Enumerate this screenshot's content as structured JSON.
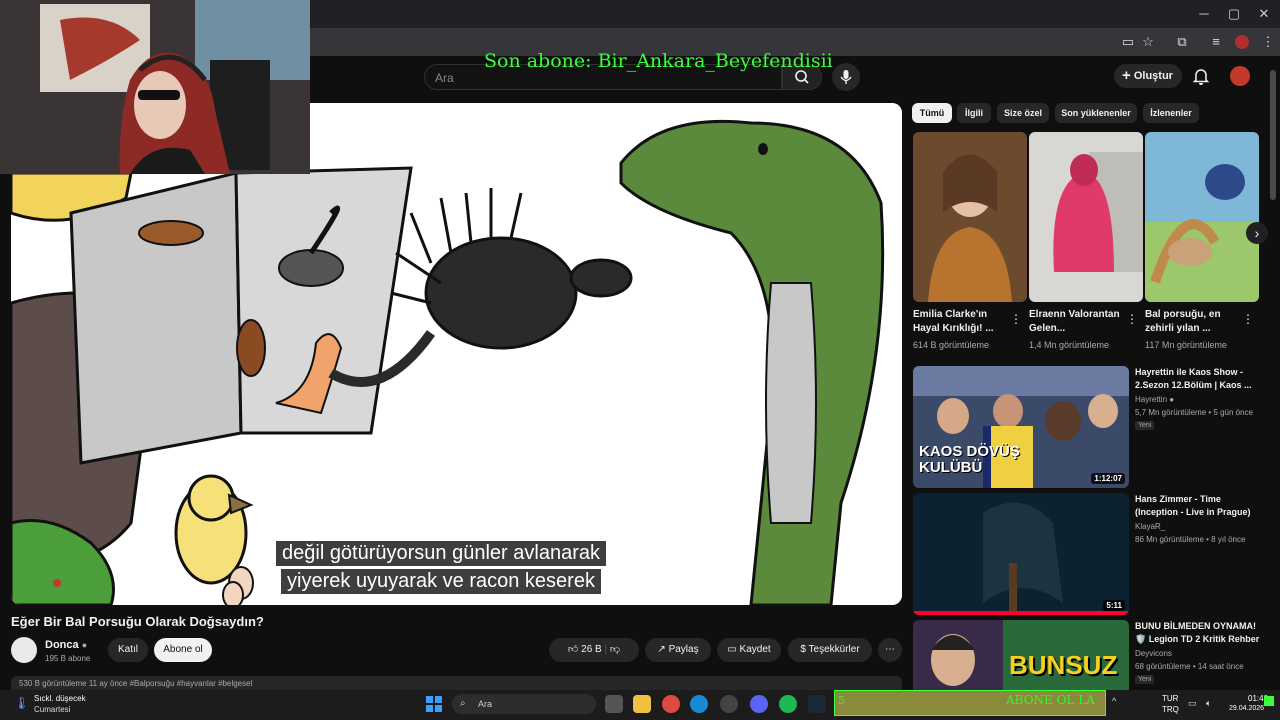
{
  "overlay": {
    "last_subscriber": "Son abone: Bir_Ankara_Beyefendisii"
  },
  "header": {
    "search_placeholder": "Ara",
    "create_label": "Oluştur"
  },
  "video": {
    "subtitle_line1": "değil götürüyorsun günler avlanarak",
    "subtitle_line2": "yiyerek uyuyarak ve racon keserek",
    "title": "Eğer Bir Bal Porsuğu Olarak Doğsaydın?",
    "channel": "Donca",
    "subscribers": "195 B abone",
    "join_label": "Katıl",
    "subscribe_label": "Abone ol",
    "likes": "26 B",
    "share_label": "Paylaş",
    "save_label": "Kaydet",
    "thanks_label": "Teşekkürler",
    "description_partial": "530 B görüntüleme  11 ay önce  #Balporsuğu #hayvanlar #belgesel"
  },
  "chips": [
    "Tümü",
    "İlgili",
    "Size özel",
    "Son yüklenenler",
    "İzlenenler"
  ],
  "shorts": [
    {
      "title": "Emilia Clarke'ın Hayal Kırıklığı! ...",
      "views": "614 B görüntüleme"
    },
    {
      "title": "Elraenn Valorantan Gelen...",
      "views": "1,4 Mn görüntüleme"
    },
    {
      "title": "Bal porsuğu, en zehirli yılan ...",
      "views": "117 Mn görüntüleme"
    }
  ],
  "recommendations": [
    {
      "title": "Hayrettin ile Kaos Show - 2.Sezon 12.Bölüm | Kaos ...",
      "channel": "Hayrettin",
      "meta": "5,7 Mn görüntüleme • 5 gün önce",
      "badge": "Yeni",
      "duration": "1:12:07",
      "thumb_text": "KAOS DÖVÜŞ KULÜBÜ"
    },
    {
      "title": "Hans Zimmer - Time (Inception - Live in Prague)",
      "channel": "KlayaR_",
      "meta": "86 Mn görüntüleme • 8 yıl önce",
      "duration": "5:11"
    },
    {
      "title": "BUNU BİLMEDEN OYNAMA! 🛡️ Legion TD 2 Kritik Rehber",
      "channel": "Deyvicons",
      "meta": "68 görüntüleme • 14 saat önce",
      "badge": "Yeni",
      "thumb_text": "BUNSUZ"
    }
  ],
  "taskbar": {
    "weather_title": "Sıckl. düşecek",
    "weather_sub": "Cumartesi",
    "search_placeholder": "Ara",
    "marquee_left": "5",
    "marquee_text": "ABONE OL LA",
    "lang1": "TUR",
    "lang2": "TRQ",
    "time": "01:40",
    "date": "29.04.2026"
  }
}
